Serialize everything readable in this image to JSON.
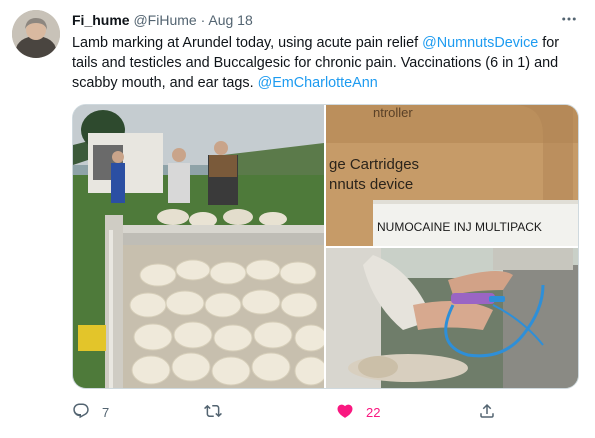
{
  "tweet": {
    "name": "Fi_hume",
    "handle": "@FiHume",
    "separator": "·",
    "date": "Aug 18",
    "text_1": "Lamb marking at Arundel today, using acute pain relief ",
    "mention_1": "@NumnutsDevice",
    "text_2": " for tails and testicles and Buccalgesic for chronic pain. Vaccinations (6 in 1) and scabby mouth, and ear tags. ",
    "mention_2": "@EmCharlotteAnn"
  },
  "media": {
    "box_line1": "ge Cartridges",
    "box_line2": "nnuts device",
    "box_partial": "ntroller",
    "label": "NUMOCAINE INJ MULTIPACK"
  },
  "actions": {
    "reply_count": "7",
    "retweet_count": "",
    "like_count": "22"
  },
  "icons": {
    "reply": "reply-icon",
    "retweet": "retweet-icon",
    "like": "heart-icon",
    "share": "share-icon",
    "more": "more-icon"
  },
  "colors": {
    "link": "#1d9bf0",
    "like": "#f91880",
    "muted": "#536471",
    "text": "#0f1419"
  }
}
